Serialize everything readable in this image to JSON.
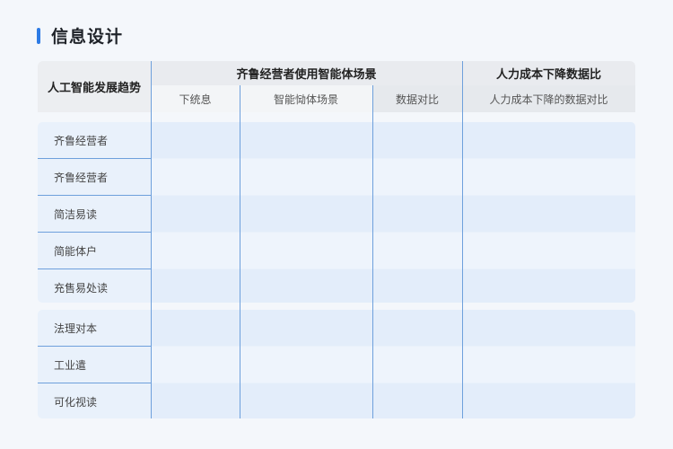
{
  "title": "信息设计",
  "table": {
    "corner_header": "人工智能发展趋势",
    "group_headers": [
      "齐鲁经营者使用智能体场景",
      "人力成本下降数据比"
    ],
    "sub_headers": [
      "下统息",
      "智能恸体场景",
      "数据对比",
      "人力成本下降的数据对比"
    ],
    "rows": [
      "齐鲁经营者",
      "齐鲁经营者",
      "简洁易读",
      "简能体户",
      "充售易处读",
      "法理对本",
      "工业遣",
      "可化视读"
    ]
  }
}
